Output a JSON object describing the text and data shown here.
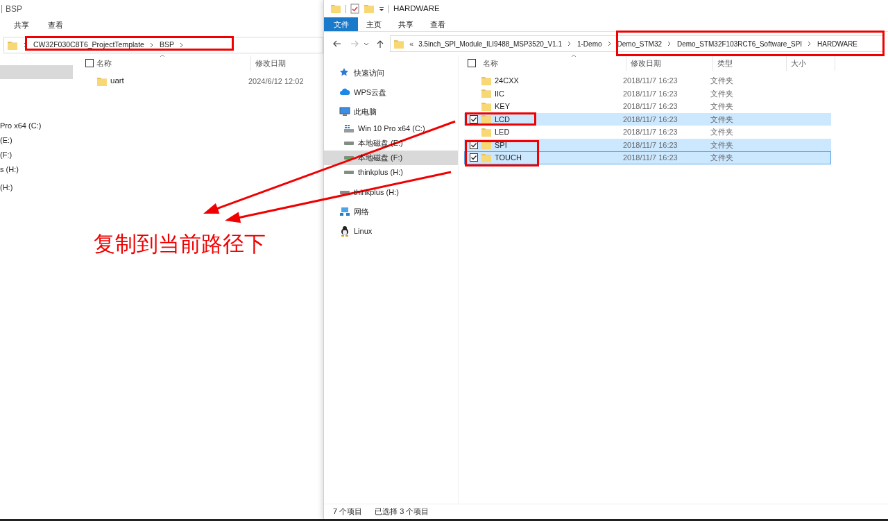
{
  "left_window": {
    "title": "BSP",
    "ribbon_tabs": [
      "共享",
      "查看"
    ],
    "breadcrumb": [
      "CW32F030C8T6_ProjectTemplate",
      "BSP"
    ],
    "nav_items": [
      "Pro x64 (C:)",
      "(E:)",
      "(F:)",
      "s (H:)",
      "(H:)"
    ],
    "columns": [
      "名称",
      "修改日期"
    ],
    "header_checked": false,
    "rows": [
      {
        "name": "uart",
        "date": "2024/6/12 12:02"
      }
    ]
  },
  "right_window": {
    "title": "HARDWARE",
    "ribbon_tabs": [
      {
        "label": "文件",
        "kind": "file"
      },
      {
        "label": "主页",
        "kind": "tab"
      },
      {
        "label": "共享",
        "kind": "tab"
      },
      {
        "label": "查看",
        "kind": "tab"
      }
    ],
    "breadcrumb_overflow": "«",
    "breadcrumb": [
      "3.5inch_SPI_Module_ILI9488_MSP3520_V1.1",
      "1-Demo",
      "Demo_STM32",
      "Demo_STM32F103RCT6_Software_SPI",
      "HARDWARE"
    ],
    "nav_items": [
      {
        "label": "快速访问",
        "kind": "star",
        "selected": false
      },
      {
        "label": "WPS云盘",
        "kind": "cloud",
        "selected": false
      },
      {
        "label": "此电脑",
        "kind": "pc",
        "selected": false,
        "children": [
          {
            "label": "Win 10 Pro x64 (C:)",
            "kind": "windrive",
            "selected": false
          },
          {
            "label": "本地磁盘 (E:)",
            "kind": "drive",
            "selected": false
          },
          {
            "label": "本地磁盘 (F:)",
            "kind": "drive",
            "selected": true
          },
          {
            "label": "thinkplus (H:)",
            "kind": "drive",
            "selected": false
          }
        ]
      },
      {
        "label": "thinkplus (H:)",
        "kind": "drive",
        "selected": false
      },
      {
        "label": "网络",
        "kind": "network",
        "selected": false
      },
      {
        "label": "Linux",
        "kind": "linux",
        "selected": false
      }
    ],
    "columns": [
      "名称",
      "修改日期",
      "类型",
      "大小"
    ],
    "header_checked": false,
    "rows": [
      {
        "name": "24CXX",
        "date": "2018/11/7 16:23",
        "type": "文件夹",
        "selected": false,
        "focused": false
      },
      {
        "name": "IIC",
        "date": "2018/11/7 16:23",
        "type": "文件夹",
        "selected": false,
        "focused": false
      },
      {
        "name": "KEY",
        "date": "2018/11/7 16:23",
        "type": "文件夹",
        "selected": false,
        "focused": false
      },
      {
        "name": "LCD",
        "date": "2018/11/7 16:23",
        "type": "文件夹",
        "selected": true,
        "focused": false
      },
      {
        "name": "LED",
        "date": "2018/11/7 16:23",
        "type": "文件夹",
        "selected": false,
        "focused": false
      },
      {
        "name": "SPI",
        "date": "2018/11/7 16:23",
        "type": "文件夹",
        "selected": true,
        "focused": false
      },
      {
        "name": "TOUCH",
        "date": "2018/11/7 16:23",
        "type": "文件夹",
        "selected": true,
        "focused": true
      }
    ],
    "status": {
      "count": "7 个项目",
      "selection": "已选择 3 个项目"
    }
  },
  "annotation": {
    "caption": "复制到当前路径下"
  }
}
